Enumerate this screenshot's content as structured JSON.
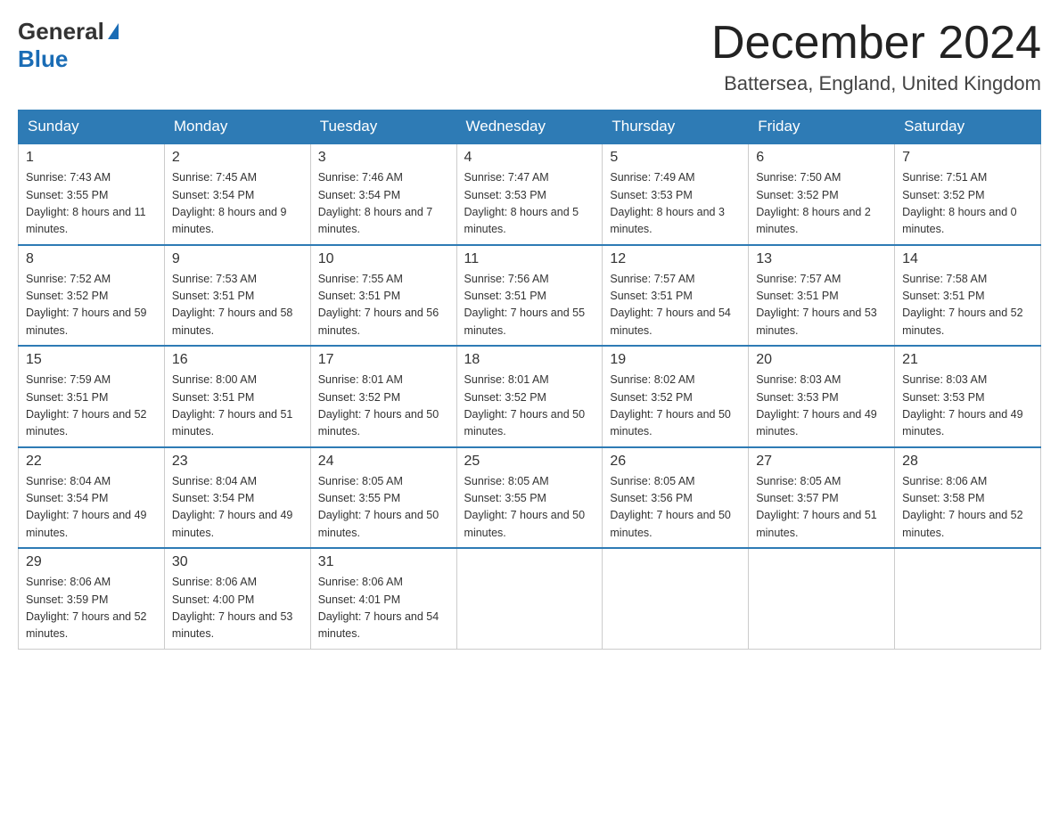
{
  "logo": {
    "general": "General",
    "arrow": "▶",
    "blue": "Blue"
  },
  "title": "December 2024",
  "subtitle": "Battersea, England, United Kingdom",
  "headers": [
    "Sunday",
    "Monday",
    "Tuesday",
    "Wednesday",
    "Thursday",
    "Friday",
    "Saturday"
  ],
  "weeks": [
    [
      {
        "num": "1",
        "sunrise": "7:43 AM",
        "sunset": "3:55 PM",
        "daylight": "8 hours and 11 minutes."
      },
      {
        "num": "2",
        "sunrise": "7:45 AM",
        "sunset": "3:54 PM",
        "daylight": "8 hours and 9 minutes."
      },
      {
        "num": "3",
        "sunrise": "7:46 AM",
        "sunset": "3:54 PM",
        "daylight": "8 hours and 7 minutes."
      },
      {
        "num": "4",
        "sunrise": "7:47 AM",
        "sunset": "3:53 PM",
        "daylight": "8 hours and 5 minutes."
      },
      {
        "num": "5",
        "sunrise": "7:49 AM",
        "sunset": "3:53 PM",
        "daylight": "8 hours and 3 minutes."
      },
      {
        "num": "6",
        "sunrise": "7:50 AM",
        "sunset": "3:52 PM",
        "daylight": "8 hours and 2 minutes."
      },
      {
        "num": "7",
        "sunrise": "7:51 AM",
        "sunset": "3:52 PM",
        "daylight": "8 hours and 0 minutes."
      }
    ],
    [
      {
        "num": "8",
        "sunrise": "7:52 AM",
        "sunset": "3:52 PM",
        "daylight": "7 hours and 59 minutes."
      },
      {
        "num": "9",
        "sunrise": "7:53 AM",
        "sunset": "3:51 PM",
        "daylight": "7 hours and 58 minutes."
      },
      {
        "num": "10",
        "sunrise": "7:55 AM",
        "sunset": "3:51 PM",
        "daylight": "7 hours and 56 minutes."
      },
      {
        "num": "11",
        "sunrise": "7:56 AM",
        "sunset": "3:51 PM",
        "daylight": "7 hours and 55 minutes."
      },
      {
        "num": "12",
        "sunrise": "7:57 AM",
        "sunset": "3:51 PM",
        "daylight": "7 hours and 54 minutes."
      },
      {
        "num": "13",
        "sunrise": "7:57 AM",
        "sunset": "3:51 PM",
        "daylight": "7 hours and 53 minutes."
      },
      {
        "num": "14",
        "sunrise": "7:58 AM",
        "sunset": "3:51 PM",
        "daylight": "7 hours and 52 minutes."
      }
    ],
    [
      {
        "num": "15",
        "sunrise": "7:59 AM",
        "sunset": "3:51 PM",
        "daylight": "7 hours and 52 minutes."
      },
      {
        "num": "16",
        "sunrise": "8:00 AM",
        "sunset": "3:51 PM",
        "daylight": "7 hours and 51 minutes."
      },
      {
        "num": "17",
        "sunrise": "8:01 AM",
        "sunset": "3:52 PM",
        "daylight": "7 hours and 50 minutes."
      },
      {
        "num": "18",
        "sunrise": "8:01 AM",
        "sunset": "3:52 PM",
        "daylight": "7 hours and 50 minutes."
      },
      {
        "num": "19",
        "sunrise": "8:02 AM",
        "sunset": "3:52 PM",
        "daylight": "7 hours and 50 minutes."
      },
      {
        "num": "20",
        "sunrise": "8:03 AM",
        "sunset": "3:53 PM",
        "daylight": "7 hours and 49 minutes."
      },
      {
        "num": "21",
        "sunrise": "8:03 AM",
        "sunset": "3:53 PM",
        "daylight": "7 hours and 49 minutes."
      }
    ],
    [
      {
        "num": "22",
        "sunrise": "8:04 AM",
        "sunset": "3:54 PM",
        "daylight": "7 hours and 49 minutes."
      },
      {
        "num": "23",
        "sunrise": "8:04 AM",
        "sunset": "3:54 PM",
        "daylight": "7 hours and 49 minutes."
      },
      {
        "num": "24",
        "sunrise": "8:05 AM",
        "sunset": "3:55 PM",
        "daylight": "7 hours and 50 minutes."
      },
      {
        "num": "25",
        "sunrise": "8:05 AM",
        "sunset": "3:55 PM",
        "daylight": "7 hours and 50 minutes."
      },
      {
        "num": "26",
        "sunrise": "8:05 AM",
        "sunset": "3:56 PM",
        "daylight": "7 hours and 50 minutes."
      },
      {
        "num": "27",
        "sunrise": "8:05 AM",
        "sunset": "3:57 PM",
        "daylight": "7 hours and 51 minutes."
      },
      {
        "num": "28",
        "sunrise": "8:06 AM",
        "sunset": "3:58 PM",
        "daylight": "7 hours and 52 minutes."
      }
    ],
    [
      {
        "num": "29",
        "sunrise": "8:06 AM",
        "sunset": "3:59 PM",
        "daylight": "7 hours and 52 minutes."
      },
      {
        "num": "30",
        "sunrise": "8:06 AM",
        "sunset": "4:00 PM",
        "daylight": "7 hours and 53 minutes."
      },
      {
        "num": "31",
        "sunrise": "8:06 AM",
        "sunset": "4:01 PM",
        "daylight": "7 hours and 54 minutes."
      },
      null,
      null,
      null,
      null
    ]
  ]
}
